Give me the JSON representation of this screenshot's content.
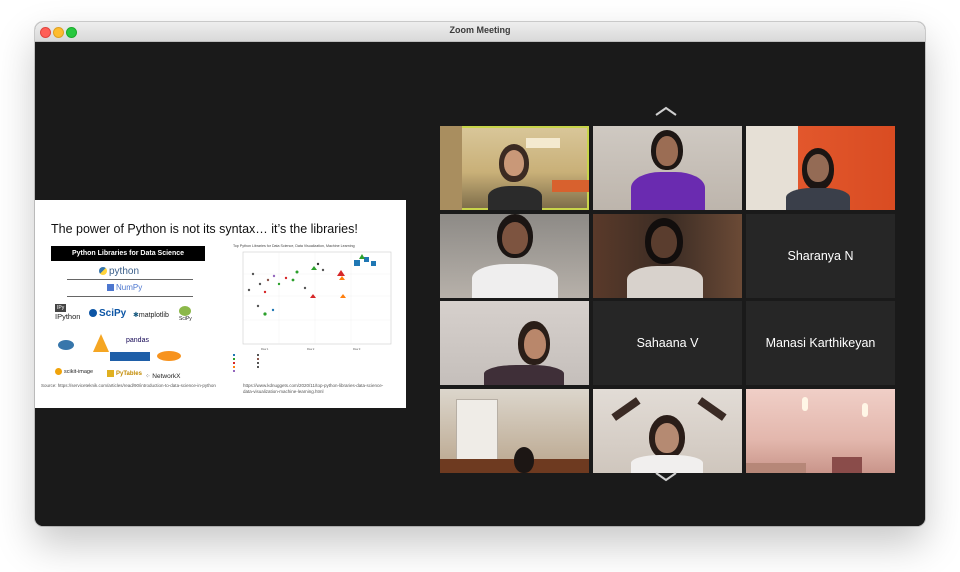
{
  "window": {
    "title": "Zoom Meeting"
  },
  "slide": {
    "title": "The power of Python is not its syntax… it’s the libraries!",
    "libraries_header": "Python Libraries for Data Science",
    "logos": [
      "python",
      "NumPy",
      "IPython",
      "SciPy",
      "matplotlib",
      "SciPy",
      "pandas",
      "scikit-image",
      "PyTables",
      "NetworkX"
    ],
    "chart_title": "Top Python Libraries for Data Science, Data Visualization, Machine Learning",
    "source_left": "Source: https://serviceteknik.com/articles/read/90/introduction-to-data-science-in-python",
    "source_right": "https://www.kdnuggets.com/2020/11/top-python-libraries-data-science-data-visualization-machine-learning.html"
  },
  "participants": [
    {
      "name": "",
      "video": true,
      "active_speaker": true
    },
    {
      "name": "",
      "video": true
    },
    {
      "name": "",
      "video": true
    },
    {
      "name": "",
      "video": true
    },
    {
      "name": "",
      "video": true
    },
    {
      "name": "Sharanya N",
      "video": false
    },
    {
      "name": "",
      "video": true
    },
    {
      "name": "Sahaana V",
      "video": false
    },
    {
      "name": "Manasi Karthikeyan",
      "video": false
    },
    {
      "name": "",
      "video": true
    },
    {
      "name": "",
      "video": true
    },
    {
      "name": "",
      "video": true
    }
  ],
  "controls": {
    "scroll_up_icon": "chevron-up-icon",
    "scroll_down_icon": "chevron-down-icon"
  },
  "colors": {
    "active_speaker_border": "#c8d44a",
    "background": "#1a1a1a"
  }
}
